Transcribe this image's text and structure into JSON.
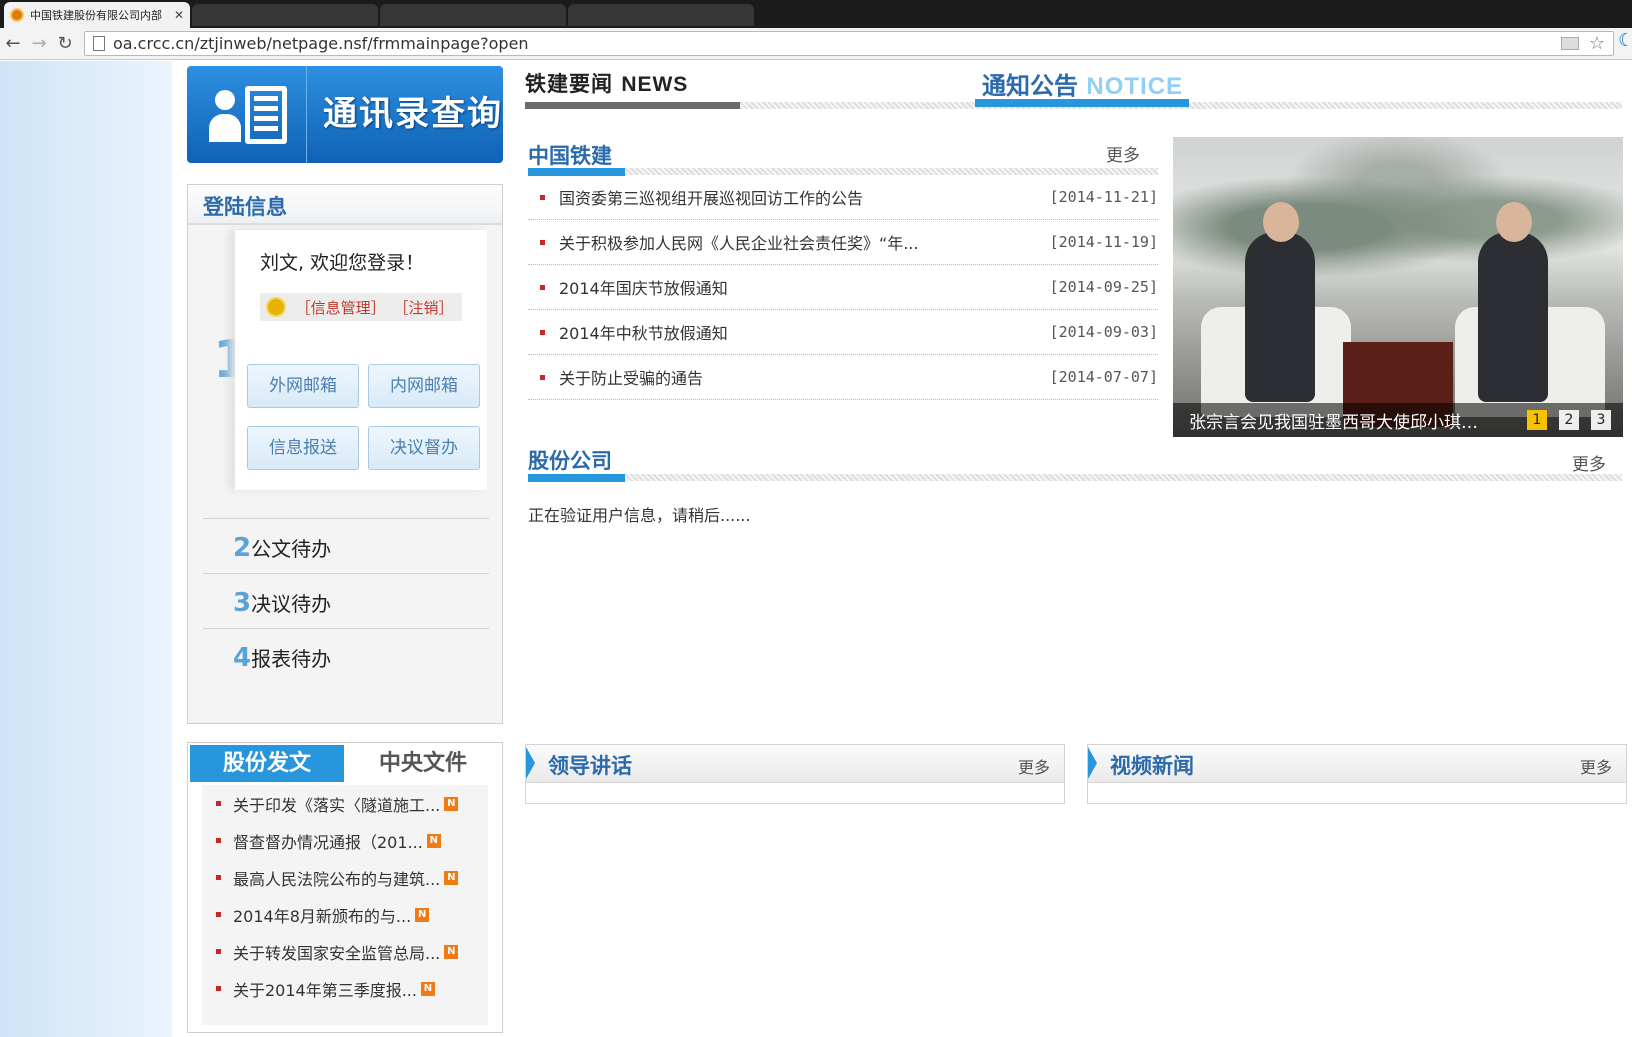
{
  "browser": {
    "tab_title": "中国铁建股份有限公司内部",
    "url": "oa.crcc.cn/ztjinweb/netpage.nsf/frmmainpage?open"
  },
  "banner": {
    "title": "通讯录查询"
  },
  "login": {
    "title": "登陆信息",
    "welcome": "刘文, 欢迎您登录！",
    "info_manage": "［信息管理］",
    "logout": "［注销］",
    "number": "1",
    "buttons": [
      "外网邮箱",
      "内网邮箱",
      "信息报送",
      "决议督办"
    ],
    "todos": [
      {
        "num": "2",
        "label": "公文待办"
      },
      {
        "num": "3",
        "label": "决议待办"
      },
      {
        "num": "4",
        "label": "报表待办"
      }
    ]
  },
  "docs": {
    "tabs": [
      "股份发文",
      "中央文件"
    ],
    "items": [
      "关于印发《落实〈隧道施工...",
      "督查督办情况通报（201...",
      "最高人民法院公布的与建筑...",
      "2014年8月新颁布的与...",
      "关于转发国家安全监管总局...",
      "关于2014年第三季度报..."
    ],
    "new_badge": "N"
  },
  "tabs": {
    "news_cn": "铁建要闻",
    "news_en": "NEWS",
    "notice_cn": "通知公告",
    "notice_en": "NOTICE"
  },
  "crcc": {
    "title": "中国铁建",
    "more": "更多",
    "items": [
      {
        "text": "国资委第三巡视组开展巡视回访工作的公告",
        "date": "[2014-11-21]"
      },
      {
        "text": "关于积极参加人民网《人民企业社会责任奖》“年...",
        "date": "[2014-11-19]"
      },
      {
        "text": "2014年国庆节放假通知",
        "date": "[2014-09-25]"
      },
      {
        "text": "2014年中秋节放假通知",
        "date": "[2014-09-03]"
      },
      {
        "text": "关于防止受骗的通告",
        "date": "[2014-07-07]"
      }
    ]
  },
  "photo": {
    "caption": "张宗言会见我国驻墨西哥大使邱小琪…",
    "pages": [
      "1",
      "2",
      "3"
    ]
  },
  "company": {
    "title": "股份公司",
    "more": "更多",
    "loading": "正在验证用户信息，请稍后......"
  },
  "panels": {
    "speech": {
      "title": "领导讲话",
      "more": "更多"
    },
    "video": {
      "title": "视频新闻",
      "more": "更多"
    }
  },
  "colors": {
    "accent": "#2896dd",
    "title_blue": "#2b6aab",
    "bullet_red": "#c62828"
  }
}
